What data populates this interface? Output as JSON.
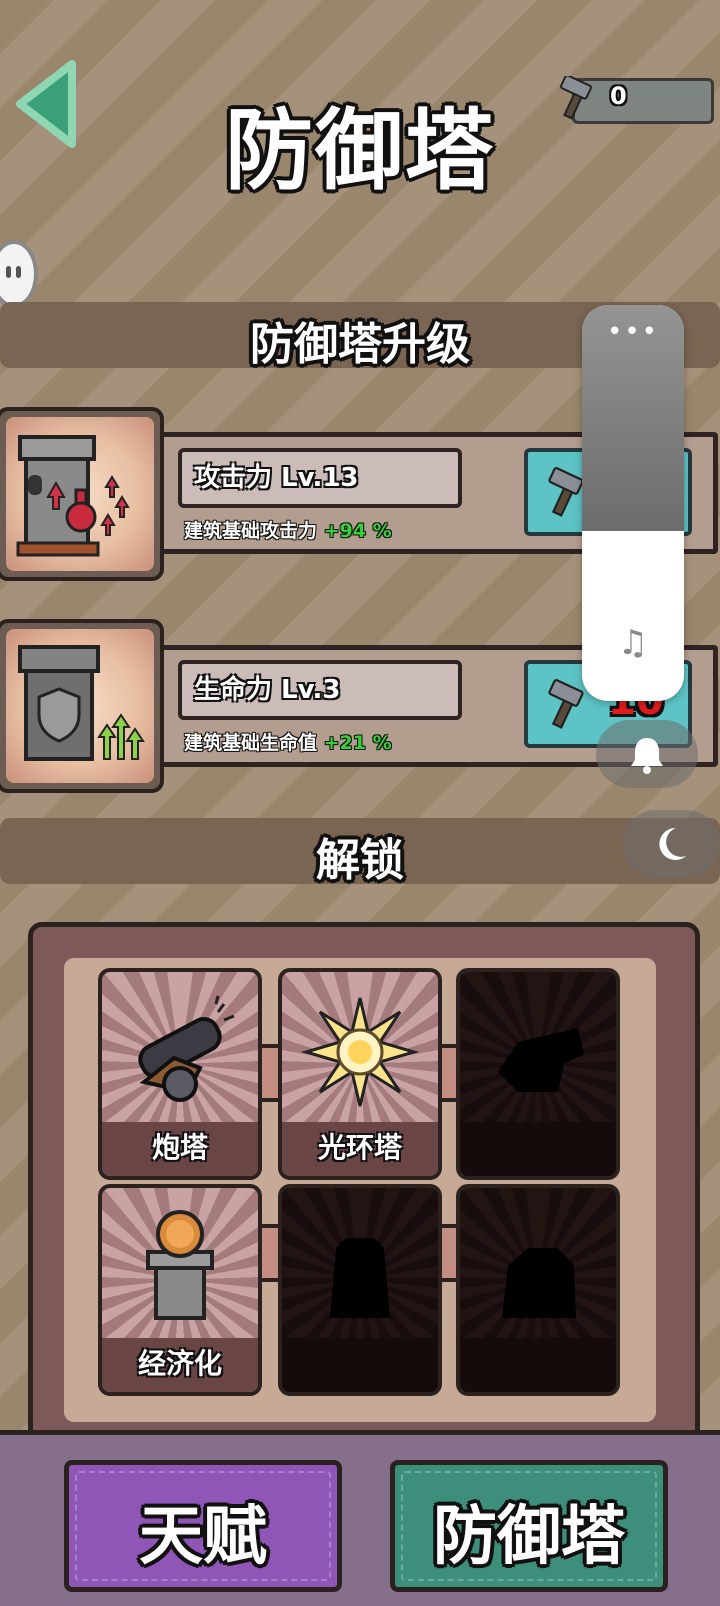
{
  "header": {
    "title": "防御塔",
    "back_label": "back",
    "resource_count": "0"
  },
  "sections": {
    "upgrade_title": "防御塔升级",
    "unlock_title": "解锁"
  },
  "upgrades": [
    {
      "label": "攻击力 Lv.13",
      "desc": "建筑基础攻击力",
      "bonus": "+94 %",
      "cost": ""
    },
    {
      "label": "生命力 Lv.3",
      "desc": "建筑基础生命值",
      "bonus": "+21 %",
      "cost": "10"
    }
  ],
  "towers": [
    {
      "name": "炮塔",
      "unlocked": true,
      "icon": "cannon-icon"
    },
    {
      "name": "光环塔",
      "unlocked": true,
      "icon": "aura-icon"
    },
    {
      "name": "",
      "unlocked": false,
      "icon": "locked-silhouette-icon"
    },
    {
      "name": "经济化",
      "unlocked": true,
      "icon": "coin-tower-icon"
    },
    {
      "name": "",
      "unlocked": false,
      "icon": "locked-silhouette-icon"
    },
    {
      "name": "",
      "unlocked": false,
      "icon": "locked-silhouette-icon"
    }
  ],
  "bottom_tabs": {
    "talent": "天赋",
    "tower": "防御塔"
  },
  "overlay": {
    "volume_dots": "•••",
    "volume_level": 0.43,
    "note_icon": "♫",
    "bell_icon": "bell-icon",
    "moon_icon": "moon-icon"
  },
  "colors": {
    "bonus_green": "#37d137",
    "cost_red": "#e31b1b",
    "talent_tab": "#8f55b7",
    "tower_tab": "#3d8f7b"
  }
}
